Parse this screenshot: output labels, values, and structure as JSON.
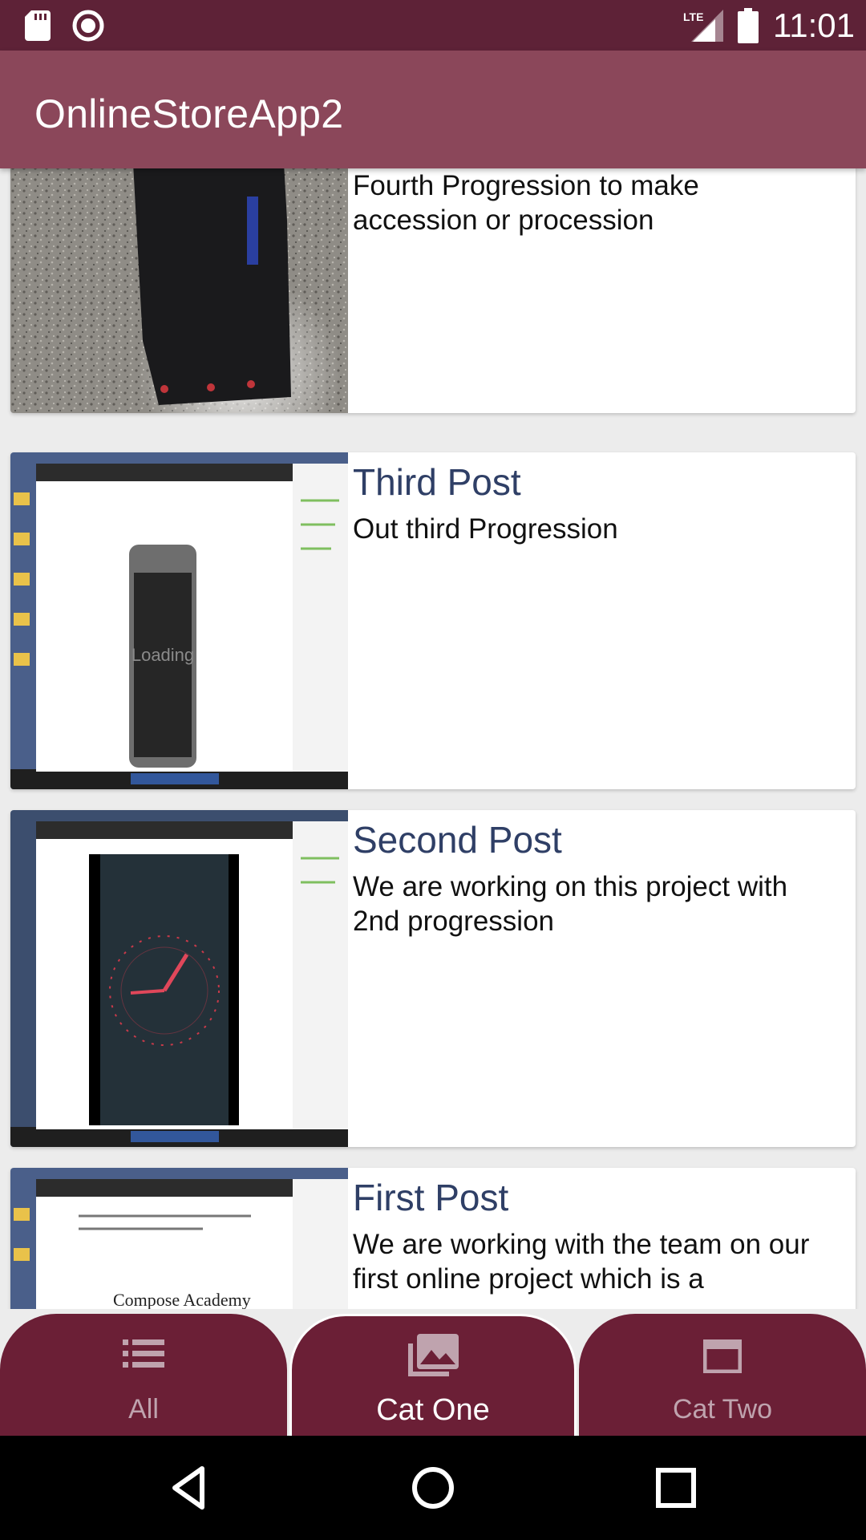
{
  "status_bar": {
    "time": "11:01",
    "network": "LTE",
    "icons": [
      "sd-card-icon",
      "recording-icon",
      "lte-signal-icon",
      "battery-icon"
    ]
  },
  "app_bar": {
    "title": "OnlineStoreApp2"
  },
  "posts": [
    {
      "title": "",
      "body": "Fourth Progression to make accession or procession",
      "thumbnail": "photo-device-on-floor"
    },
    {
      "title": "Third Post",
      "body": "Out third Progression",
      "thumbnail": "screenshot-loading-phone"
    },
    {
      "title": "Second Post",
      "body": "We are working on this project with 2nd progression",
      "thumbnail": "screenshot-dark-clock-app"
    },
    {
      "title": "First Post",
      "body": "We are working with the team on our first online project which is a",
      "thumbnail": "screenshot-compose-academy"
    }
  ],
  "thumbnail_texts": {
    "loading": "Loading",
    "compose": "Compose Academy"
  },
  "bottom_nav": {
    "tabs": [
      {
        "label": "All",
        "icon": "list-icon",
        "active": false
      },
      {
        "label": "Cat One",
        "icon": "photo-library-icon",
        "active": true
      },
      {
        "label": "Cat Two",
        "icon": "window-icon",
        "active": false
      }
    ]
  },
  "colors": {
    "status_bar": "#5e2237",
    "app_bar": "#8b475a",
    "nav_tab": "#6b1f36",
    "post_title": "#2f3f66"
  },
  "system_nav": [
    "back-icon",
    "home-icon",
    "recents-icon"
  ]
}
